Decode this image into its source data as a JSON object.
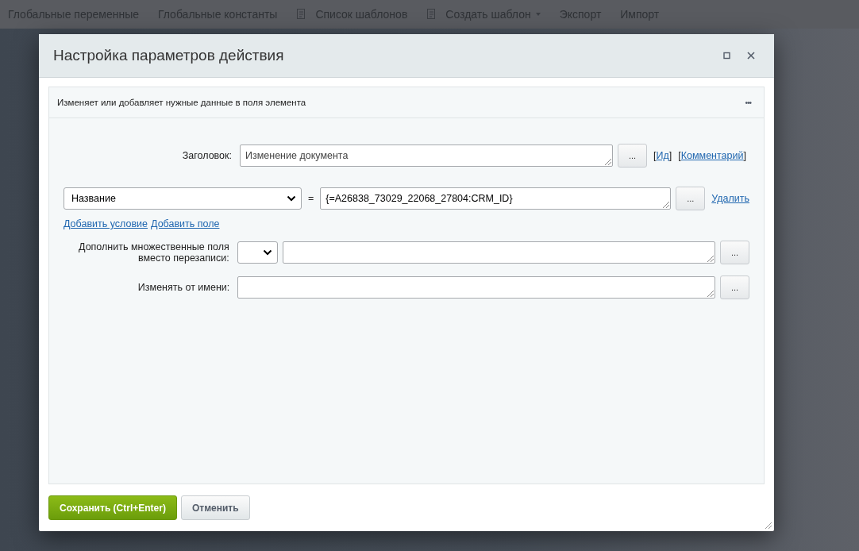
{
  "nav": [
    {
      "label": "Глобальные переменные",
      "kind": "text"
    },
    {
      "label": "Глобальные константы",
      "kind": "text"
    },
    {
      "label": "Список шаблонов",
      "kind": "icon"
    },
    {
      "label": "Создать шаблон",
      "kind": "icon-dropdown"
    },
    {
      "label": "Экспорт",
      "kind": "text"
    },
    {
      "label": "Импорт",
      "kind": "text"
    }
  ],
  "dialog": {
    "title": "Настройка параметров действия",
    "description": "Изменяет или добавляет нужные данные в поля элемента",
    "more": "•••",
    "title_field": {
      "label": "Заголовок:",
      "value": "Изменение документа",
      "button": "...",
      "links": [
        {
          "before": "[",
          "label": "Ид",
          "after": "]"
        },
        {
          "before": "[",
          "label": "Комментарий",
          "after": "]"
        }
      ]
    },
    "condition": {
      "field": "Название",
      "equals": "=",
      "value": "{=A26838_73029_22068_27804:CRM_ID}",
      "button": "...",
      "delete": "Удалить"
    },
    "add_links": [
      "Добавить условие",
      "Добавить поле"
    ],
    "rows": [
      {
        "label": "Дополнить множественные поля вместо перезаписи:",
        "kind": "select-text",
        "button": "..."
      },
      {
        "label": "Изменять от имени:",
        "kind": "text",
        "button": "..."
      }
    ],
    "buttons": [
      {
        "label": "Сохранить (Ctrl+Enter)",
        "kind": "primary"
      },
      {
        "label": "Отменить",
        "kind": "secondary"
      }
    ]
  }
}
